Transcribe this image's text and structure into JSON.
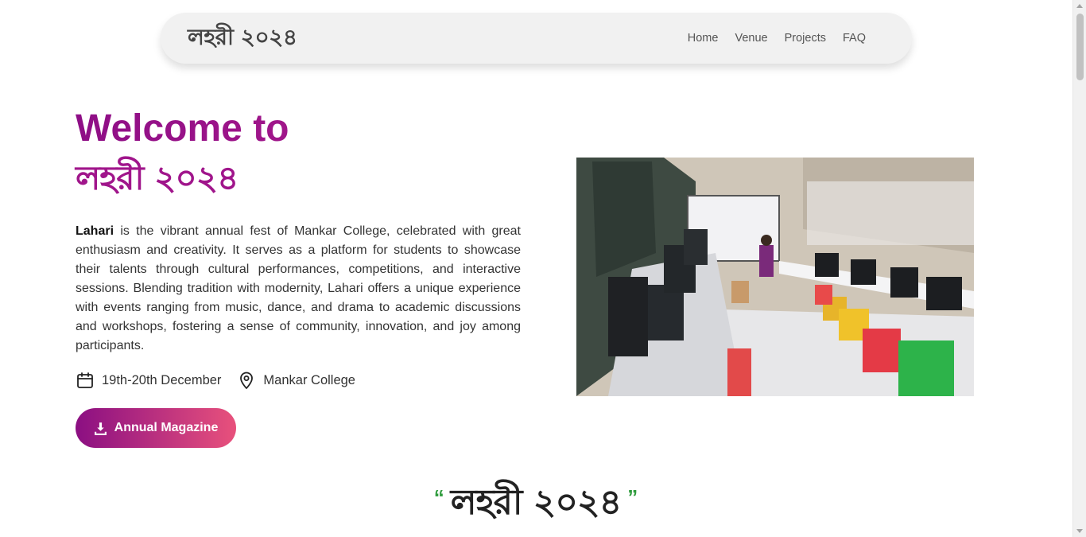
{
  "nav": {
    "brand": "লহরী ২০২৪",
    "links": [
      "Home",
      "Venue",
      "Projects",
      "FAQ"
    ]
  },
  "hero": {
    "welcome": "Welcome to",
    "title_bangla": "লহরী ২০২৪",
    "description_bold": "Lahari",
    "description_rest": " is the vibrant annual fest of Mankar College, celebrated with great enthusiasm and creativity. It serves as a platform for students to showcase their talents through cultural performances, competitions, and interactive sessions. Blending tradition with modernity, Lahari offers a unique experience with events ranging from music, dance, and drama to academic discussions and workshops, fostering a sense of community, innovation, and joy among participants.",
    "date": "19th-20th December",
    "venue": "Mankar College",
    "magazine_button": "Annual Magazine"
  },
  "section": {
    "open_quote": "“",
    "title_bangla": "লহরী ২০২৪",
    "close_quote": "”"
  },
  "colors": {
    "accent_purple": "#8e0e86",
    "button_gradient_end": "#e8517c",
    "quote_green": "#2e9b3c"
  },
  "icons": {
    "date": "calendar-icon",
    "venue": "map-pin-icon",
    "download": "download-icon"
  }
}
